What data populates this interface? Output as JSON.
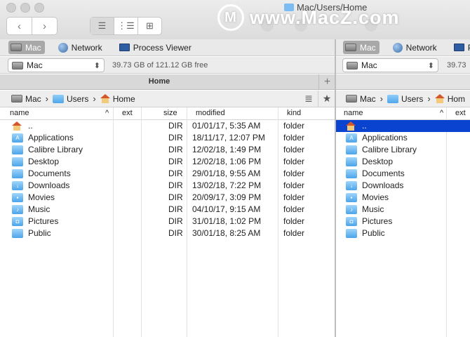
{
  "window": {
    "title": "Mac/Users/Home",
    "watermark": "www.MacZ.com",
    "watermark_logo": "M"
  },
  "toolbar": {
    "back": "‹",
    "forward": "›",
    "views": [
      "list-view-icon",
      "outline-view-icon",
      "grid-view-icon"
    ]
  },
  "locations": [
    "Mac",
    "Network",
    "Process Viewer"
  ],
  "volume": {
    "selected": "Mac",
    "free": "39.73 GB of 121.12 GB free"
  },
  "tab": {
    "title": "Home",
    "add": "+"
  },
  "breadcrumb": [
    "Mac",
    "Users",
    "Home"
  ],
  "columns": {
    "name": "name",
    "ext": "ext",
    "size": "size",
    "modified": "modified",
    "kind": "kind",
    "sort_indicator": "^"
  },
  "files": [
    {
      "name": "..",
      "ext": "",
      "size": "DIR",
      "modified": "01/01/17, 5:35 AM",
      "kind": "folder",
      "icon": "home-icon"
    },
    {
      "name": "Applications",
      "ext": "",
      "size": "DIR",
      "modified": "18/11/17, 12:07 PM",
      "kind": "folder",
      "icon": "A"
    },
    {
      "name": "Calibre Library",
      "ext": "",
      "size": "DIR",
      "modified": "12/02/18, 1:49 PM",
      "kind": "folder",
      "icon": ""
    },
    {
      "name": "Desktop",
      "ext": "",
      "size": "DIR",
      "modified": "12/02/18, 1:06 PM",
      "kind": "folder",
      "icon": ""
    },
    {
      "name": "Documents",
      "ext": "",
      "size": "DIR",
      "modified": "29/01/18, 9:55 AM",
      "kind": "folder",
      "icon": ""
    },
    {
      "name": "Downloads",
      "ext": "",
      "size": "DIR",
      "modified": "13/02/18, 7:22 PM",
      "kind": "folder",
      "icon": "↓"
    },
    {
      "name": "Movies",
      "ext": "",
      "size": "DIR",
      "modified": "20/09/17, 3:09 PM",
      "kind": "folder",
      "icon": "▪"
    },
    {
      "name": "Music",
      "ext": "",
      "size": "DIR",
      "modified": "04/10/17, 9:15 AM",
      "kind": "folder",
      "icon": "♪"
    },
    {
      "name": "Pictures",
      "ext": "",
      "size": "DIR",
      "modified": "31/01/18, 1:02 PM",
      "kind": "folder",
      "icon": "◘"
    },
    {
      "name": "Public",
      "ext": "",
      "size": "DIR",
      "modified": "30/01/18, 8:25 AM",
      "kind": "folder",
      "icon": ""
    }
  ],
  "right_pane": {
    "locations": [
      "Mac",
      "Network",
      "Pr"
    ],
    "volume_selected": "Mac",
    "free_partial": "39.73",
    "breadcrumb": [
      "Mac",
      "Users",
      "Hom"
    ],
    "selected_row": 0
  },
  "colors": {
    "selection": "#0a43d0",
    "folder": "#4aa4ea",
    "location_selected": "#a8a8a8"
  }
}
